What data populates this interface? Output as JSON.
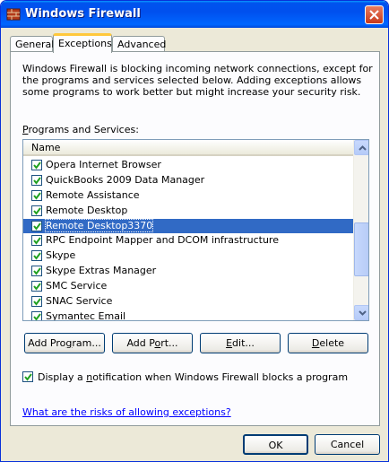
{
  "window": {
    "title": "Windows Firewall",
    "title_icon": "firewall-icon"
  },
  "tabs": [
    {
      "label": "General"
    },
    {
      "label": "Exceptions",
      "active": true
    },
    {
      "label": "Advanced"
    }
  ],
  "exceptions": {
    "intro": "Windows Firewall is blocking incoming network connections, except for the programs and services selected below. Adding exceptions allows some programs to work better but might increase your security risk.",
    "programs_label_pre": "",
    "programs_label_ul": "P",
    "programs_label_post": "rograms and Services:",
    "column_header": "Name",
    "items": [
      {
        "name": "Opera Internet Browser",
        "checked": true
      },
      {
        "name": "QuickBooks 2009 Data Manager",
        "checked": true
      },
      {
        "name": "Remote Assistance",
        "checked": true
      },
      {
        "name": "Remote Desktop",
        "checked": true
      },
      {
        "name": "Remote Desktop3370",
        "checked": true,
        "selected": true
      },
      {
        "name": "RPC Endpoint Mapper and DCOM infrastructure",
        "checked": true
      },
      {
        "name": "Skype",
        "checked": true
      },
      {
        "name": "Skype Extras Manager",
        "checked": true
      },
      {
        "name": "SMC Service",
        "checked": true
      },
      {
        "name": "SNAC Service",
        "checked": true
      },
      {
        "name": "Symantec Email",
        "checked": true
      }
    ],
    "buttons": {
      "add_program": {
        "pre": "Add Pro",
        "ul": "g",
        "post": "ram..."
      },
      "add_port": {
        "pre": "Add P",
        "ul": "o",
        "post": "rt..."
      },
      "edit": {
        "pre": "",
        "ul": "E",
        "post": "dit..."
      },
      "delete": {
        "pre": "",
        "ul": "D",
        "post": "elete"
      }
    },
    "notify": {
      "checked": true,
      "pre": "Display a ",
      "ul": "n",
      "post": "otification when Windows Firewall blocks a program"
    },
    "risk_link": "What are the risks of allowing exceptions?"
  },
  "footer": {
    "ok": "OK",
    "cancel": "Cancel"
  }
}
